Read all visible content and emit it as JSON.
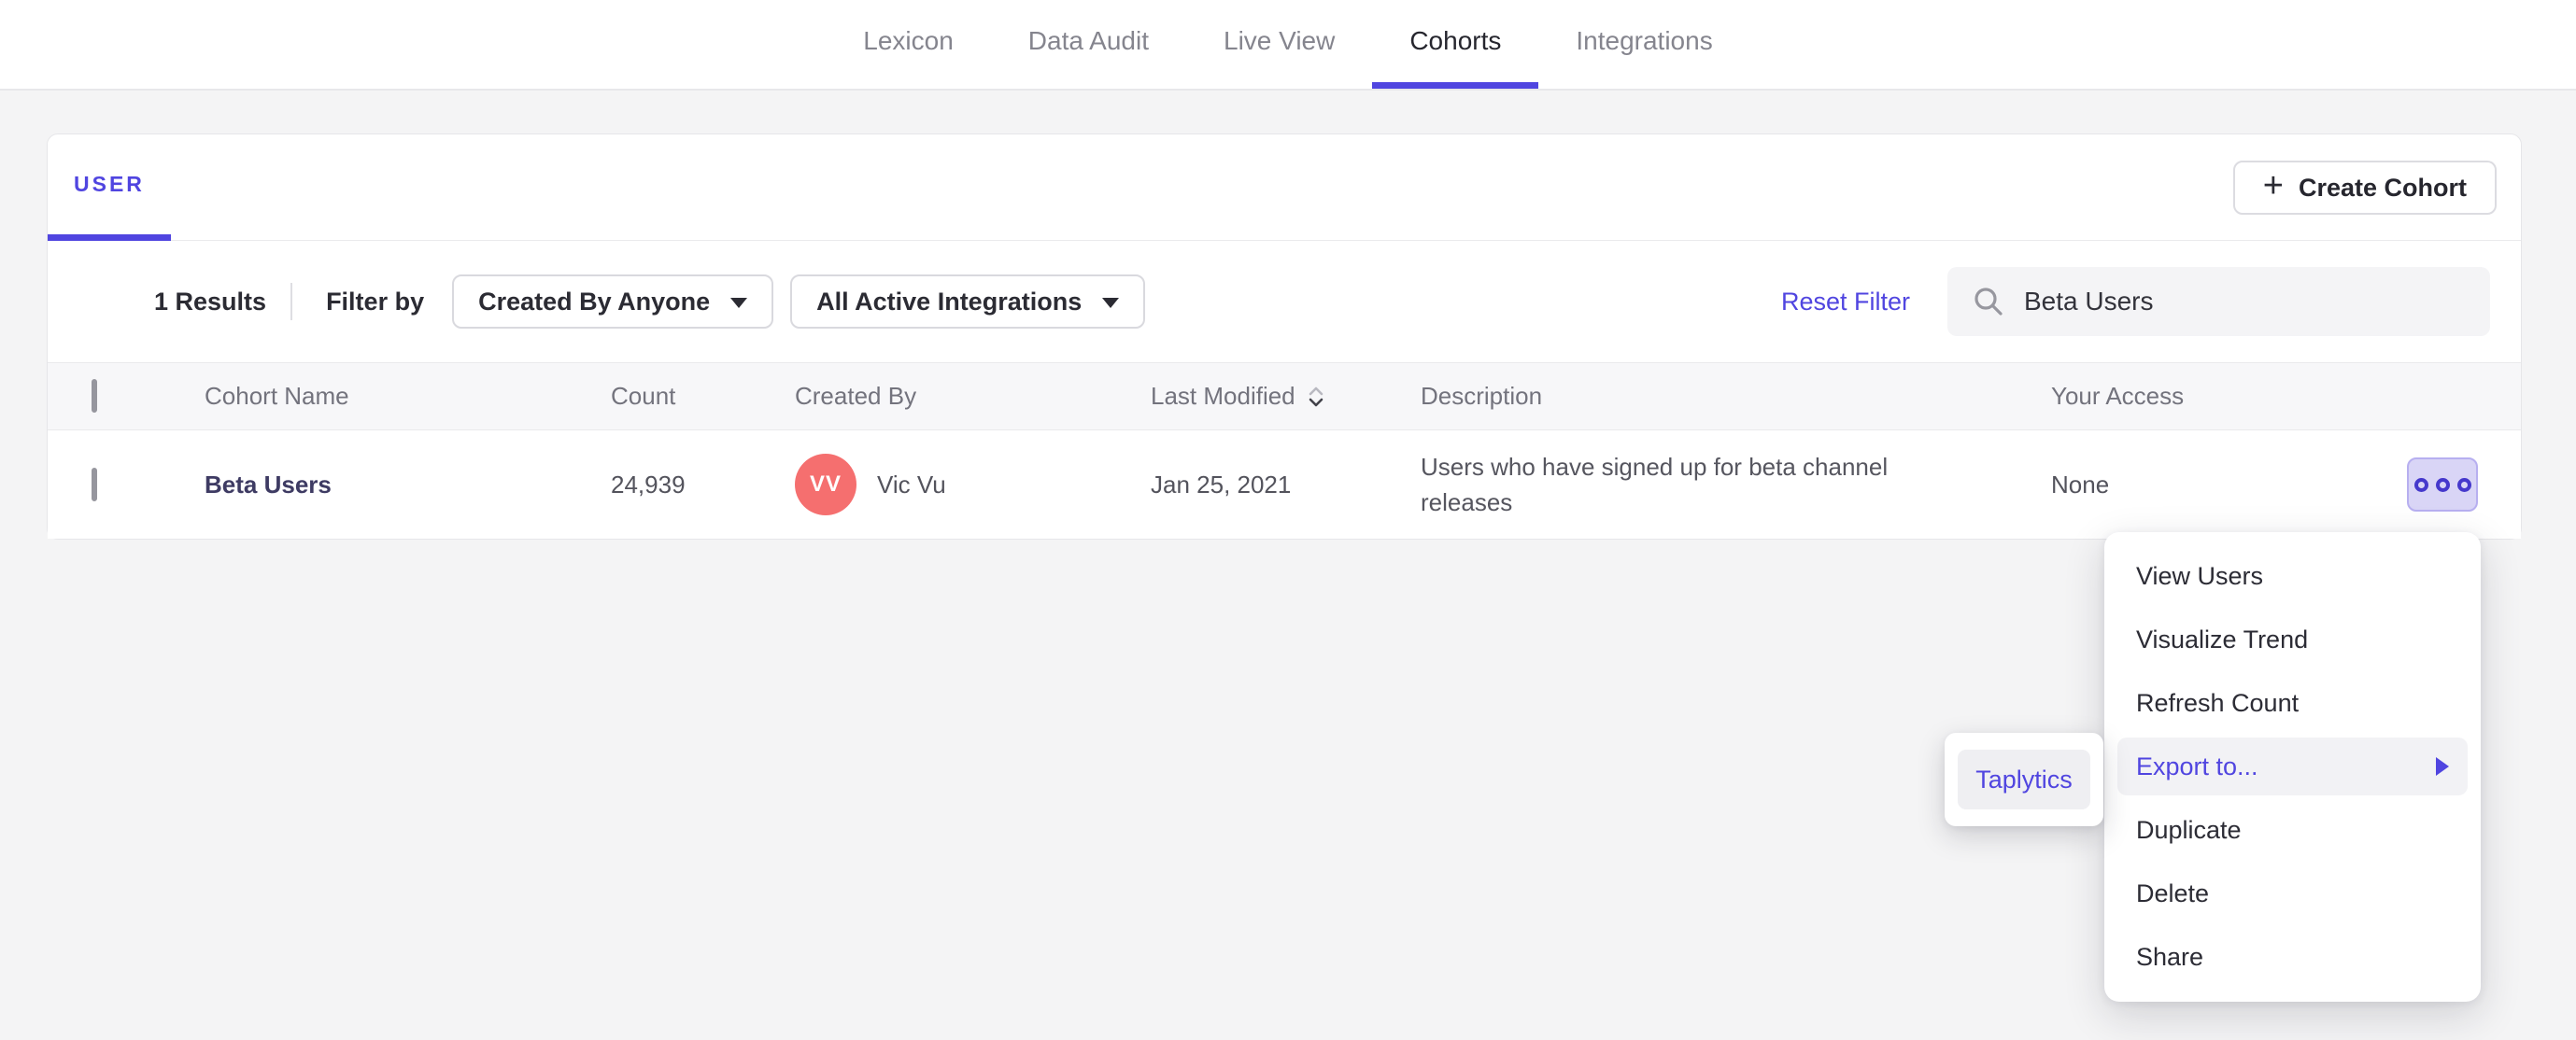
{
  "nav": {
    "items": [
      {
        "label": "Lexicon",
        "active": false
      },
      {
        "label": "Data Audit",
        "active": false
      },
      {
        "label": "Live View",
        "active": false
      },
      {
        "label": "Cohorts",
        "active": true
      },
      {
        "label": "Integrations",
        "active": false
      }
    ]
  },
  "card": {
    "tab_label": "USER",
    "create_button": {
      "plus": "+",
      "label": "Create Cohort"
    }
  },
  "filters": {
    "results_count": "1 Results",
    "filter_by_label": "Filter by",
    "created_by_dropdown": "Created By Anyone",
    "integrations_dropdown": "All Active Integrations",
    "reset_link": "Reset Filter",
    "search": {
      "value": "Beta Users",
      "icon": "search-icon"
    }
  },
  "table": {
    "headers": {
      "name": "Cohort Name",
      "count": "Count",
      "created_by": "Created By",
      "last_modified": "Last Modified",
      "description": "Description",
      "access": "Your Access"
    },
    "row": {
      "name": "Beta Users",
      "count": "24,939",
      "avatar_initials": "VV",
      "created_by": "Vic Vu",
      "last_modified": "Jan 25, 2021",
      "description": "Users who have signed up for beta channel releases",
      "access": "None"
    }
  },
  "context_menu": {
    "items": [
      "View Users",
      "Visualize Trend",
      "Refresh Count",
      "Export to...",
      "Duplicate",
      "Delete",
      "Share"
    ],
    "highlighted_item": "Export to...",
    "submenu_items": [
      "Taplytics"
    ]
  },
  "colors": {
    "accent": "#5045e0",
    "avatar": "#f56f6f",
    "active_tab_underline": "#5045e0",
    "kebab_dots": "#4538cc"
  }
}
